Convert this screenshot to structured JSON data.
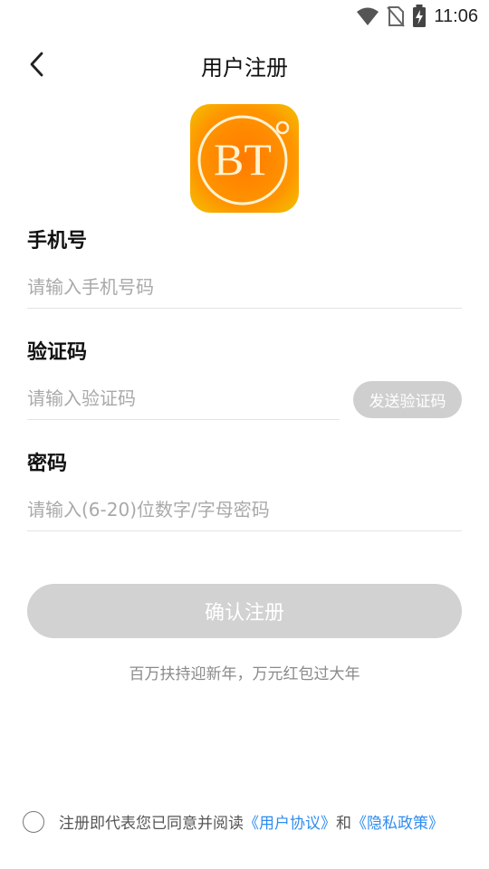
{
  "status_bar": {
    "time": "11:06",
    "icons": [
      "wifi-icon",
      "no-sim-icon",
      "battery-charging-icon"
    ]
  },
  "header": {
    "title": "用户注册",
    "back_icon": "chevron-left-icon"
  },
  "logo": {
    "text": "BT",
    "colors": {
      "outer": "#f5a800",
      "inner": "#ff7a00",
      "ring": "#fff3d0"
    }
  },
  "form": {
    "phone_label": "手机号",
    "phone_placeholder": "请输入手机号码",
    "code_label": "验证码",
    "code_placeholder": "请输入验证码",
    "send_code_label": "发送验证码",
    "password_label": "密码",
    "password_placeholder": "请输入(6-20)位数字/字母密码",
    "submit_label": "确认注册"
  },
  "promo_text": "百万扶持迎新年，万元红包过大年",
  "agreement": {
    "prefix": "注册即代表您已同意并阅读",
    "user_agreement": "《用户协议》",
    "connector": "和",
    "privacy_policy": "《隐私政策》"
  },
  "colors": {
    "link": "#2f8cf0",
    "button_disabled": "#d2d2d2",
    "placeholder": "#a9a9a9"
  }
}
